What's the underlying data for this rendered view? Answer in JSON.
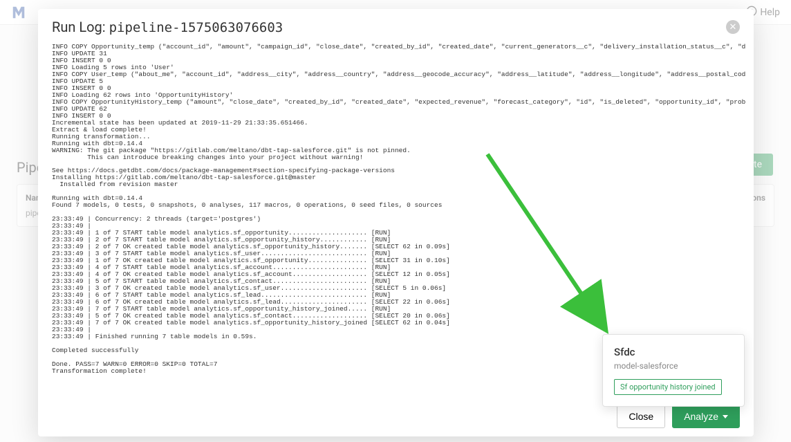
{
  "header": {
    "help_label": "Help"
  },
  "page": {
    "section_heading": "Pipelines",
    "table_col_name": "Name",
    "table_col_actions": "Actions",
    "row_name_prefix": "pipe",
    "create_button_suffix": "eate"
  },
  "modal": {
    "title_prefix": "Run Log: ",
    "pipeline_id": "pipeline-1575063076603",
    "close_label": "Close",
    "analyze_label": "Analyze"
  },
  "popover": {
    "title": "Sfdc",
    "subtitle": "model-salesforce",
    "item": "Sf opportunity history joined"
  },
  "log_lines": [
    "INFO COPY Opportunity_temp (\"account_id\", \"amount\", \"campaign_id\", \"close_date\", \"created_by_id\", \"created_date\", \"current_generators__c\", \"delivery_installation_status__c\", \"description\", \"expected_revenue\", \"fiscal\", \"fiscal_quart",
    "INFO UPDATE 31",
    "INFO INSERT 0 0",
    "INFO Loading 5 rows into 'User'",
    "INFO COPY User_temp (\"about_me\", \"account_id\", \"address__city\", \"address__country\", \"address__geocode_accuracy\", \"address__latitude\", \"address__longitude\", \"address__postal_code\", \"address__state\", \"address__street\", \"alias\", \"badg",
    "INFO UPDATE 5",
    "INFO INSERT 0 0",
    "INFO Loading 62 rows into 'OpportunityHistory'",
    "INFO COPY OpportunityHistory_temp (\"amount\", \"close_date\", \"created_by_id\", \"created_date\", \"expected_revenue\", \"forecast_category\", \"id\", \"is_deleted\", \"opportunity_id\", \"probability\", \"stage_name\", \"system_modstamp\") FROM STDIN WIT",
    "INFO UPDATE 62",
    "INFO INSERT 0 0",
    "Incremental state has been updated at 2019-11-29 21:33:35.651466.",
    "Extract & load complete!",
    "Running transformation...",
    "Running with dbt=0.14.4",
    "WARNING: The git package \"https://gitlab.com/meltano/dbt-tap-salesforce.git\" is not pinned.",
    "         This can introduce breaking changes into your project without warning!",
    "",
    "See https://docs.getdbt.com/docs/package-management#section-specifying-package-versions",
    "Installing https://gitlab.com/meltano/dbt-tap-salesforce.git@master",
    "  Installed from revision master",
    "",
    "Running with dbt=0.14.4",
    "Found 7 models, 0 tests, 0 snapshots, 0 analyses, 117 macros, 0 operations, 0 seed files, 0 sources",
    "",
    "23:33:49 | Concurrency: 2 threads (target='postgres')",
    "23:33:49 |",
    "23:33:49 | 1 of 7 START table model analytics.sf_opportunity.................... [RUN]",
    "23:33:49 | 2 of 7 START table model analytics.sf_opportunity_history............ [RUN]",
    "23:33:49 | 2 of 7 OK created table model analytics.sf_opportunity_history....... [SELECT 62 in 0.09s]",
    "23:33:49 | 3 of 7 START table model analytics.sf_user........................... [RUN]",
    "23:33:49 | 1 of 7 OK created table model analytics.sf_opportunity............... [SELECT 31 in 0.10s]",
    "23:33:49 | 4 of 7 START table model analytics.sf_account........................ [RUN]",
    "23:33:49 | 4 of 7 OK created table model analytics.sf_account................... [SELECT 12 in 0.05s]",
    "23:33:49 | 5 of 7 START table model analytics.sf_contact........................ [RUN]",
    "23:33:49 | 3 of 7 OK created table model analytics.sf_user...................... [SELECT 5 in 0.06s]",
    "23:33:49 | 6 of 7 START table model analytics.sf_lead........................... [RUN]",
    "23:33:49 | 6 of 7 OK created table model analytics.sf_lead...................... [SELECT 22 in 0.06s]",
    "23:33:49 | 7 of 7 START table model analytics.sf_opportunity_history_joined..... [RUN]",
    "23:33:49 | 5 of 7 OK created table model analytics.sf_contact................... [SELECT 20 in 0.06s]",
    "23:33:49 | 7 of 7 OK created table model analytics.sf_opportunity_history_joined [SELECT 62 in 0.04s]",
    "23:33:49 |",
    "23:33:49 | Finished running 7 table models in 0.59s.",
    "",
    "Completed successfully",
    "",
    "Done. PASS=7 WARN=0 ERROR=0 SKIP=0 TOTAL=7",
    "Transformation complete!"
  ]
}
